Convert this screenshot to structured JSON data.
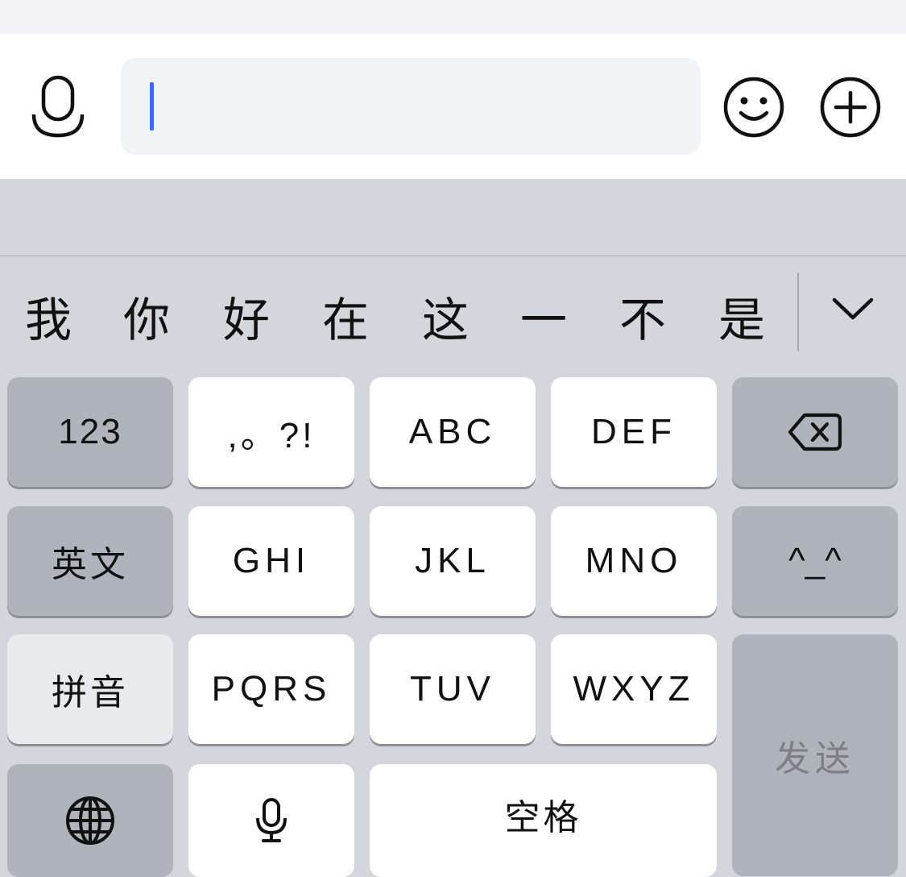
{
  "input_bar": {
    "voice_icon": "microphone-outline-icon",
    "emoji_icon": "smiley-face-icon",
    "add_icon": "plus-circle-icon",
    "text_value": ""
  },
  "candidates": [
    "我",
    "你",
    "好",
    "在",
    "这",
    "一",
    "不",
    "是"
  ],
  "candidate_expand_icon": "chevron-down-icon",
  "keyboard": {
    "row1": {
      "numbers": "123",
      "punct": ",。?!",
      "abc": "ABC",
      "def": "DEF",
      "delete_icon": "backspace-icon"
    },
    "row2": {
      "english": "英文",
      "ghi": "GHI",
      "jkl": "JKL",
      "mno": "MNO",
      "emoticon": "^_^"
    },
    "row3": {
      "pinyin": "拼音",
      "pqrs": "PQRS",
      "tuv": "TUV",
      "wxyz": "WXYZ"
    },
    "row4": {
      "globe_icon": "globe-icon",
      "mic_icon": "microphone-icon",
      "space": "空格"
    },
    "send": "发送"
  },
  "colors": {
    "caret": "#3a6df0",
    "keyboard_bg": "#d4d6db",
    "dark_key": "#afb3bc"
  }
}
